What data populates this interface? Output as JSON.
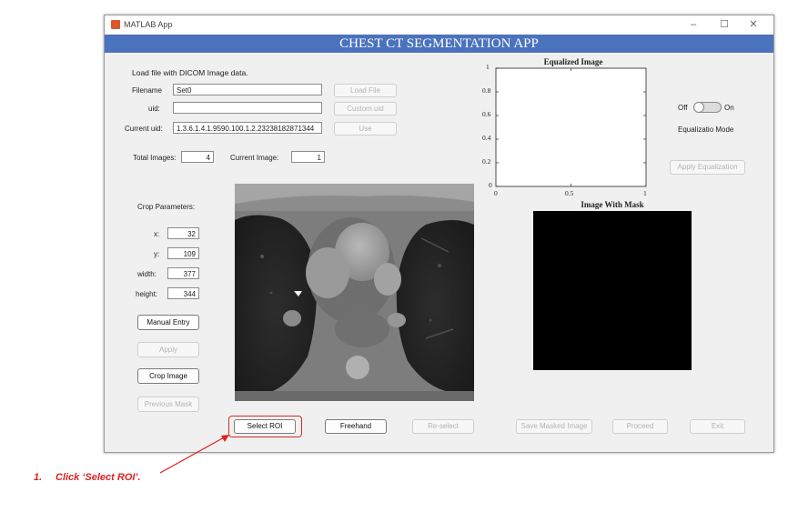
{
  "window": {
    "title": "MATLAB App",
    "banner": "CHEST CT SEGMENTATION APP"
  },
  "titlebar_controls": [
    "–",
    "☐",
    "✕"
  ],
  "file_panel": {
    "heading": "Load file with DICOM Image data.",
    "filename_label": "Filename",
    "filename_value": "Set0",
    "uid_label": "uid:",
    "uid_value": "",
    "current_uid_label": "Current uid:",
    "current_uid_value": "1.3.6.1.4.1.9590.100.1.2.23238182871344",
    "load_file_button": "Load File",
    "custom_uid_button": "Custom uid",
    "use_button": "Use"
  },
  "counts": {
    "total_images_label": "Total Images:",
    "total_images_value": "4",
    "current_image_label": "Current Image:",
    "current_image_value": "1"
  },
  "crop": {
    "heading": "Crop Parameters:",
    "x_label": "x:",
    "x_value": "32",
    "y_label": "y:",
    "y_value": "109",
    "width_label": "width:",
    "width_value": "377",
    "height_label": "height:",
    "height_value": "344",
    "manual_entry_button": "Manual Entry",
    "apply_button": "Apply",
    "crop_image_button": "Crop Image",
    "previous_mask_button": "Previous Mask"
  },
  "equalized_plot": {
    "title": "Equalized Image",
    "y_ticks": [
      "1",
      "0.8",
      "0.6",
      "0.4",
      "0.2",
      "0"
    ],
    "x_ticks": [
      "0",
      "0.5",
      "1"
    ]
  },
  "equalization": {
    "off_label": "Off",
    "on_label": "On",
    "toggle_state": "off",
    "mode_label": "Equalizatio Mode",
    "apply_button": "Apply Equalization"
  },
  "mask_panel": {
    "title": "Image With Mask"
  },
  "bottom_buttons": {
    "select_roi": "Select ROI",
    "freehand": "Freehand",
    "reselect": "Re-select",
    "save_masked": "Save Masked Image",
    "proceed": "Proceed",
    "exit": "Exit"
  },
  "annotation": {
    "step": "1.",
    "text": "Click ‘Select ROI’."
  },
  "colors": {
    "banner": "#4a72bd",
    "annotation": "#e02020",
    "window_bg": "#f0f0f0"
  }
}
